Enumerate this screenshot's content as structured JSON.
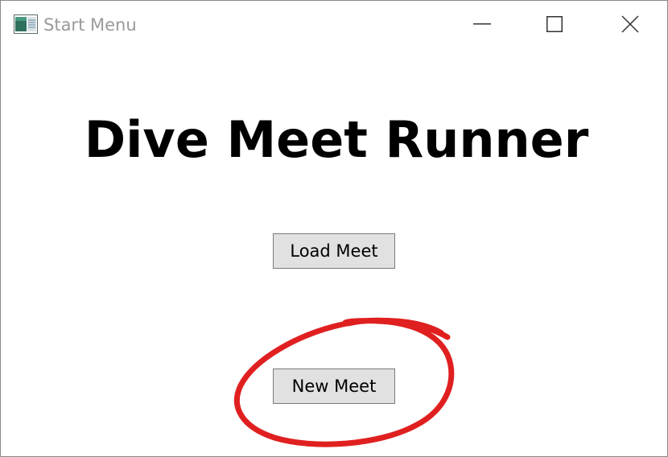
{
  "window": {
    "title": "Start Menu",
    "icon": "app-window-icon",
    "controls": {
      "minimize_icon": "minimize-icon",
      "maximize_icon": "maximize-icon",
      "close_icon": "close-icon"
    }
  },
  "main": {
    "heading": "Dive Meet Runner",
    "buttons": {
      "load_label": "Load Meet",
      "new_label": "New Meet"
    }
  },
  "annotation": {
    "type": "hand-drawn-circle",
    "target": "New Meet",
    "color": "#e02020"
  },
  "colors": {
    "button_bg": "#e1e1e1",
    "button_border": "#7a7a7a",
    "title_text": "#9a9a9a",
    "annotation": "#e02020"
  }
}
